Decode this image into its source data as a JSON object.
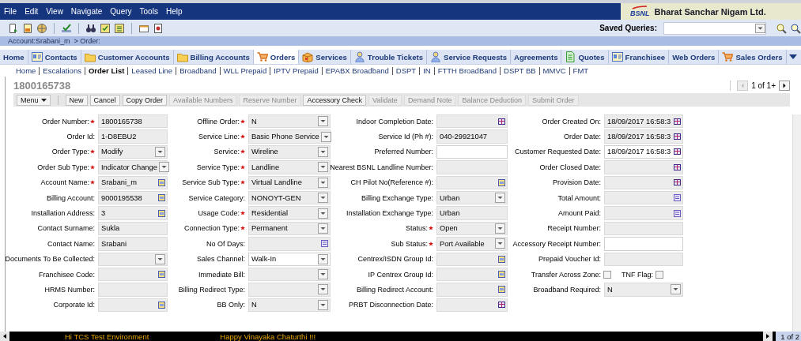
{
  "menu_bar": {
    "items": [
      "File",
      "Edit",
      "View",
      "Navigate",
      "Query",
      "Tools",
      "Help"
    ],
    "logo": {
      "mark": "BSNL",
      "name": "Bharat Sanchar Nigam Ltd."
    }
  },
  "toolbar": {
    "saved_queries_label": "Saved Queries:"
  },
  "breadcrumb": "Account:Srabani_m  > Order:",
  "tabs": [
    {
      "label": "Home",
      "kind": "plain",
      "selected": false
    },
    {
      "label": "Contacts",
      "kind": "card",
      "selected": false
    },
    {
      "label": "Customer Accounts",
      "kind": "folder",
      "selected": false
    },
    {
      "label": "Billing Accounts",
      "kind": "folder",
      "selected": false
    },
    {
      "label": "Orders",
      "kind": "cart",
      "selected": true
    },
    {
      "label": "Services",
      "kind": "box",
      "selected": false
    },
    {
      "label": "Trouble Tickets",
      "kind": "person",
      "selected": false
    },
    {
      "label": "Service Requests",
      "kind": "person",
      "selected": false
    },
    {
      "label": "Agreements",
      "kind": "plain",
      "selected": false
    },
    {
      "label": "Quotes",
      "kind": "document",
      "selected": false
    },
    {
      "label": "Franchisee",
      "kind": "card",
      "selected": false
    },
    {
      "label": "Web Orders",
      "kind": "plain",
      "selected": false
    },
    {
      "label": "Sales Orders",
      "kind": "cart",
      "selected": false
    }
  ],
  "subnav": [
    {
      "label": "Home",
      "selected": false
    },
    {
      "label": "Escalations",
      "selected": false
    },
    {
      "label": "Order List",
      "selected": true
    },
    {
      "label": "Leased Line",
      "selected": false
    },
    {
      "label": "Broadband",
      "selected": false
    },
    {
      "label": "WLL Prepaid",
      "selected": false
    },
    {
      "label": "IPTV Prepaid",
      "selected": false
    },
    {
      "label": "EPABX Broadband",
      "selected": false
    },
    {
      "label": "DSPT",
      "selected": false
    },
    {
      "label": "IN",
      "selected": false
    },
    {
      "label": "FTTH BroadBand",
      "selected": false
    },
    {
      "label": "DSPT BB",
      "selected": false
    },
    {
      "label": "MMVC",
      "selected": false
    },
    {
      "label": "FMT",
      "selected": false
    }
  ],
  "record_title": "1800165738",
  "pager": "1 of 1+",
  "buttons": [
    {
      "label": "Menu",
      "kind": "menu",
      "disabled": false
    },
    {
      "label": "New",
      "kind": "button",
      "disabled": false
    },
    {
      "label": "Cancel",
      "kind": "button",
      "disabled": false
    },
    {
      "label": "Copy Order",
      "kind": "button",
      "disabled": false
    },
    {
      "label": "Available Numbers",
      "kind": "button",
      "disabled": true
    },
    {
      "label": "Reserve Number",
      "kind": "button",
      "disabled": true
    },
    {
      "label": "Accessory Check",
      "kind": "button",
      "disabled": false
    },
    {
      "label": "Validate",
      "kind": "button",
      "disabled": true
    },
    {
      "label": "Demand Note",
      "kind": "button",
      "disabled": true
    },
    {
      "label": "Balance Deduction",
      "kind": "button",
      "disabled": true
    },
    {
      "label": "Submit Order",
      "kind": "button",
      "disabled": true
    }
  ],
  "form": {
    "rows": [
      {
        "cells": [
          {
            "label": "Order Number:",
            "required": true,
            "kind": "text",
            "readonly": true,
            "value": "1800165738"
          },
          {
            "label": "Offline Order:",
            "required": true,
            "kind": "select",
            "readonly": true,
            "value": "N"
          },
          {
            "label": "Indoor Completion Date:",
            "required": false,
            "kind": "date",
            "readonly": true
          },
          {
            "label": "Order Created On:",
            "required": false,
            "kind": "date",
            "readonly": true,
            "value": "18/09/2017 16:58:3"
          }
        ]
      },
      {
        "cells": [
          {
            "label": "Order Id:",
            "required": false,
            "kind": "text",
            "readonly": true,
            "value": "1-D8EBU2"
          },
          {
            "label": "Service Line:",
            "required": true,
            "kind": "select",
            "readonly": true,
            "value": "Basic Phone Service"
          },
          {
            "label": "Service Id (Ph #):",
            "required": false,
            "kind": "text",
            "readonly": true,
            "value": "040-29921047"
          },
          {
            "label": "Order Date:",
            "required": false,
            "kind": "date",
            "readonly": true,
            "value": "18/09/2017 16:58:3"
          }
        ]
      },
      {
        "cells": [
          {
            "label": "Order Type:",
            "required": true,
            "kind": "select",
            "readonly": true,
            "value": "Modify"
          },
          {
            "label": "Service:",
            "required": true,
            "kind": "select",
            "readonly": true,
            "value": "Wireline"
          },
          {
            "label": "Preferred Number:",
            "required": false,
            "kind": "text",
            "readonly": false
          },
          {
            "label": "Customer Requested Date:",
            "required": false,
            "kind": "date",
            "readonly": false,
            "value": "18/09/2017 16:58:3"
          }
        ]
      },
      {
        "cells": [
          {
            "label": "Order Sub Type:",
            "required": true,
            "kind": "select",
            "readonly": true,
            "value": "Indicator Change"
          },
          {
            "label": "Service Type:",
            "required": true,
            "kind": "select",
            "readonly": true,
            "value": "Landline"
          },
          {
            "label": "Nearest BSNL Landline Number:",
            "required": false,
            "kind": "text",
            "readonly": true
          },
          {
            "label": "Order Closed Date:",
            "required": false,
            "kind": "date",
            "readonly": true
          }
        ]
      },
      {
        "cells": [
          {
            "label": "Account Name:",
            "required": true,
            "kind": "pick",
            "readonly": true,
            "value": "Srabani_m"
          },
          {
            "label": "Service Sub Type:",
            "required": true,
            "kind": "select",
            "readonly": true,
            "value": "Virtual Landline"
          },
          {
            "label": "CH Pilot No(Reference #):",
            "required": false,
            "kind": "pick",
            "readonly": true
          },
          {
            "label": "Provision Date:",
            "required": false,
            "kind": "date",
            "readonly": true
          }
        ]
      },
      {
        "cells": [
          {
            "label": "Billing Account:",
            "required": false,
            "kind": "pick",
            "readonly": true,
            "value": "9000195538"
          },
          {
            "label": "Service Category:",
            "required": false,
            "kind": "select",
            "readonly": true,
            "value": "NONOYT-GEN"
          },
          {
            "label": "Billing Exchange Type:",
            "required": false,
            "kind": "select",
            "readonly": true,
            "value": "Urban"
          },
          {
            "label": "Total Amount:",
            "required": false,
            "kind": "calc",
            "readonly": true
          }
        ]
      },
      {
        "cells": [
          {
            "label": "Installation Address:",
            "required": false,
            "kind": "pick",
            "readonly": true,
            "value": "3"
          },
          {
            "label": "Usage Code:",
            "required": true,
            "kind": "select",
            "readonly": true,
            "value": "Residential"
          },
          {
            "label": "Installation Exchange Type:",
            "required": false,
            "kind": "text",
            "readonly": true,
            "value": "Urban"
          },
          {
            "label": "Amount Paid:",
            "required": false,
            "kind": "calc",
            "readonly": true
          }
        ]
      },
      {
        "cells": [
          {
            "label": "Contact Surname:",
            "required": false,
            "kind": "text",
            "readonly": true,
            "value": "Sukla"
          },
          {
            "label": "Connection Type:",
            "required": true,
            "kind": "select",
            "readonly": true,
            "value": "Permanent"
          },
          {
            "label": "Status:",
            "required": true,
            "kind": "select",
            "readonly": true,
            "value": "Open"
          },
          {
            "label": "Receipt Number:",
            "required": false,
            "kind": "text",
            "readonly": true
          }
        ]
      },
      {
        "cells": [
          {
            "label": "Contact Name:",
            "required": false,
            "kind": "text",
            "readonly": true,
            "value": "Srabani"
          },
          {
            "label": "No Of Days:",
            "required": false,
            "kind": "calc",
            "readonly": true
          },
          {
            "label": "Sub Status:",
            "required": true,
            "kind": "select",
            "readonly": true,
            "value": "Port Available"
          },
          {
            "label": "Accessory Receipt Number:",
            "required": false,
            "kind": "text",
            "readonly": false
          }
        ]
      },
      {
        "cells": [
          {
            "label": "Documents To Be Collected:",
            "required": false,
            "kind": "select",
            "readonly": true
          },
          {
            "label": "Sales Channel:",
            "required": false,
            "kind": "select",
            "readonly": false,
            "value": "Walk-In"
          },
          {
            "label": "Centrex/ISDN Group Id:",
            "required": false,
            "kind": "pick",
            "readonly": true
          },
          {
            "label": "Prepaid Voucher Id:",
            "required": false,
            "kind": "text",
            "readonly": true
          }
        ]
      },
      {
        "cells": [
          {
            "label": "Franchisee Code:",
            "required": false,
            "kind": "pick",
            "readonly": true
          },
          {
            "label": "Immediate Bill:",
            "required": false,
            "kind": "select",
            "readonly": true
          },
          {
            "label": "IP Centrex Group Id:",
            "required": false,
            "kind": "pick",
            "readonly": true
          },
          {
            "kind": "checks",
            "items": [
              {
                "label": "Transfer Across Zone:",
                "checked": false
              },
              {
                "label": "TNF Flag:",
                "checked": false
              }
            ]
          }
        ]
      },
      {
        "cells": [
          {
            "label": "HRMS Number:",
            "required": false,
            "kind": "text",
            "readonly": true
          },
          {
            "label": "Billing Redirect Type:",
            "required": false,
            "kind": "select",
            "readonly": true
          },
          {
            "label": "Billing Redirect Account:",
            "required": false,
            "kind": "pick",
            "readonly": true
          },
          {
            "label": "Broadband Required:",
            "required": false,
            "kind": "select",
            "readonly": true,
            "value": "N"
          }
        ]
      },
      {
        "cells": [
          {
            "label": "Corporate Id:",
            "required": false,
            "kind": "pick",
            "readonly": true
          },
          {
            "label": "BB Only:",
            "required": false,
            "kind": "select",
            "readonly": true,
            "value": "N"
          },
          {
            "label": "PRBT Disconnection Date:",
            "required": false,
            "kind": "date",
            "readonly": true
          }
        ]
      }
    ]
  },
  "status_bar": {
    "messages": [
      "Hi TCS Test Environment",
      "Happy Vinayaka Chaturthi !!!"
    ],
    "pager": "1 of 2"
  }
}
